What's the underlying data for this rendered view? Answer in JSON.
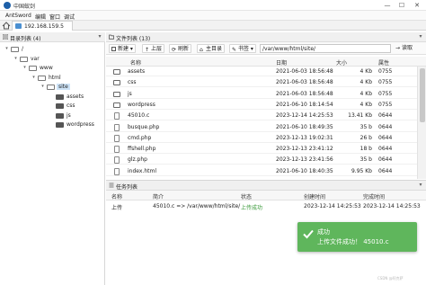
{
  "window": {
    "title": "中国蚁剑",
    "min": "—",
    "max": "☐",
    "close": "✕"
  },
  "menu": [
    "AntSword",
    "编辑",
    "窗口",
    "调试"
  ],
  "tab": {
    "label": "192.168.159.5"
  },
  "left_panel": {
    "title": "目录列表 (4)",
    "tree": [
      {
        "label": "/",
        "level": 0,
        "expanded": true
      },
      {
        "label": "var",
        "level": 1,
        "expanded": true
      },
      {
        "label": "www",
        "level": 2,
        "expanded": true
      },
      {
        "label": "html",
        "level": 3,
        "expanded": true
      },
      {
        "label": "site",
        "level": 4,
        "expanded": true,
        "selected": true
      },
      {
        "label": "assets",
        "level": 5
      },
      {
        "label": "css",
        "level": 5
      },
      {
        "label": "js",
        "level": 5
      },
      {
        "label": "wordpress",
        "level": 5
      }
    ]
  },
  "file_panel": {
    "title": "文件列表 (13)",
    "toolbar": {
      "new": "新建",
      "up": "上层",
      "refresh": "刷新",
      "home": "主目录",
      "bookmarks": "书签",
      "read": "读取"
    },
    "path": "/var/www/html/site/",
    "columns": {
      "name": "名称",
      "date": "日期",
      "size": "大小",
      "perm": "属性"
    },
    "rows": [
      {
        "type": "folder",
        "name": "assets",
        "date": "2021-06-03 18:56:48",
        "size": "4 Kb",
        "perm": "0755"
      },
      {
        "type": "folder",
        "name": "css",
        "date": "2021-06-03 18:56:48",
        "size": "4 Kb",
        "perm": "0755"
      },
      {
        "type": "folder",
        "name": "js",
        "date": "2021-06-03 18:56:48",
        "size": "4 Kb",
        "perm": "0755"
      },
      {
        "type": "folder",
        "name": "wordpress",
        "date": "2021-06-10 18:14:54",
        "size": "4 Kb",
        "perm": "0755"
      },
      {
        "type": "file",
        "name": "45010.c",
        "date": "2023-12-14 14:25:53",
        "size": "13.41 Kb",
        "perm": "0644"
      },
      {
        "type": "file",
        "name": "busque.php",
        "date": "2021-06-10 18:49:35",
        "size": "35 b",
        "perm": "0644"
      },
      {
        "type": "file",
        "name": "cmd.php",
        "date": "2023-12-13 19:02:31",
        "size": "26 b",
        "perm": "0644"
      },
      {
        "type": "file",
        "name": "ffshell.php",
        "date": "2023-12-13 23:41:12",
        "size": "18 b",
        "perm": "0644"
      },
      {
        "type": "file",
        "name": "glz.php",
        "date": "2023-12-13 23:41:56",
        "size": "35 b",
        "perm": "0644"
      },
      {
        "type": "file",
        "name": "index.html",
        "date": "2021-06-10 18:40:35",
        "size": "9.95 Kb",
        "perm": "0644"
      }
    ]
  },
  "task_panel": {
    "title": "任务列表",
    "columns": {
      "name": "名称",
      "desc": "简介",
      "status": "状态",
      "created": "创建时间",
      "done": "完成时间"
    },
    "rows": [
      {
        "name": "上传",
        "desc": "45010.c => /var/www/html/site/",
        "status": "上传成功",
        "created": "2023-12-14 14:25:53",
        "done": "2023-12-14 14:25:53"
      }
    ]
  },
  "toast": {
    "title": "成功",
    "message": "上传文件成功！ 45010.c"
  },
  "watermark": "CSDN @阿克萨",
  "colors": {
    "accent": "#4a8fd1",
    "success": "#5fb65c",
    "success_text": "#3a9a3a"
  }
}
